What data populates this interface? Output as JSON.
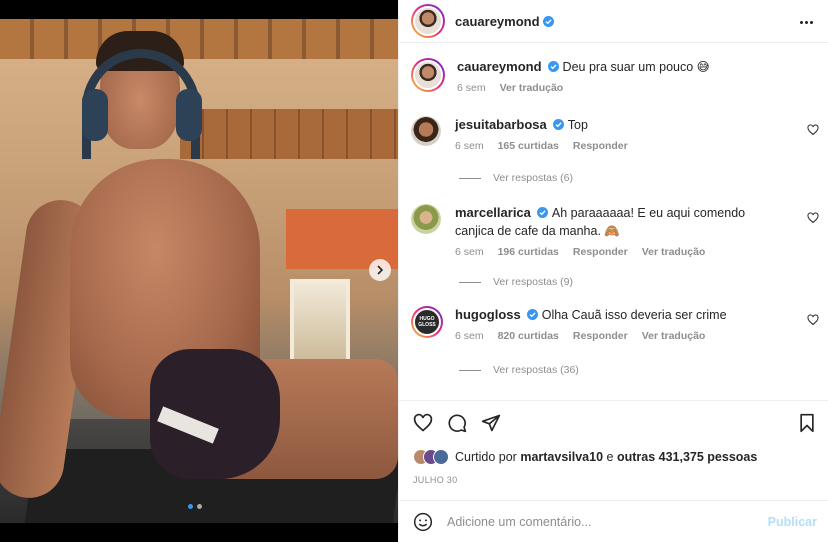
{
  "post": {
    "author": {
      "username": "cauareymond",
      "verified": true,
      "avatar_icon": "avatar-photo"
    },
    "caption": {
      "username": "cauareymond",
      "text": "Deu pra suar um pouco 😅",
      "time": "6 sem",
      "translate": "Ver tradução"
    },
    "comments": [
      {
        "username": "jesuitabarbosa",
        "verified": true,
        "text": "Top",
        "time": "6 sem",
        "likes": "165 curtidas",
        "reply": "Responder",
        "translate": "",
        "replies": "Ver respostas (6)"
      },
      {
        "username": "marcellarica",
        "verified": true,
        "text": "Ah paraaaaaa! E eu aqui comendo canjica de cafe da manha. 🙈",
        "time": "6 sem",
        "likes": "196 curtidas",
        "reply": "Responder",
        "translate": "Ver tradução",
        "replies": "Ver respostas (9)"
      },
      {
        "username": "hugogloss",
        "verified": true,
        "text": "Olha Cauã isso deveria ser crime",
        "time": "6 sem",
        "likes": "820 curtidas",
        "reply": "Responder",
        "translate": "Ver tradução",
        "replies": "Ver respostas (36)"
      }
    ],
    "hugogloss_avatar_text": "HUGO GLOSS",
    "likes": {
      "prefix": "Curtido por",
      "user": "martavsilva10",
      "middle": "e",
      "others": "outras 431,375 pessoas"
    },
    "date": "JULHO 30",
    "add_comment": {
      "placeholder": "Adicione um comentário...",
      "publish": "Publicar"
    },
    "carousel": {
      "count": 2,
      "active": 1
    },
    "colors": {
      "verified": "#3897f0",
      "publish_disabled": "#b2dffc",
      "muted": "#8e8e8e"
    }
  }
}
